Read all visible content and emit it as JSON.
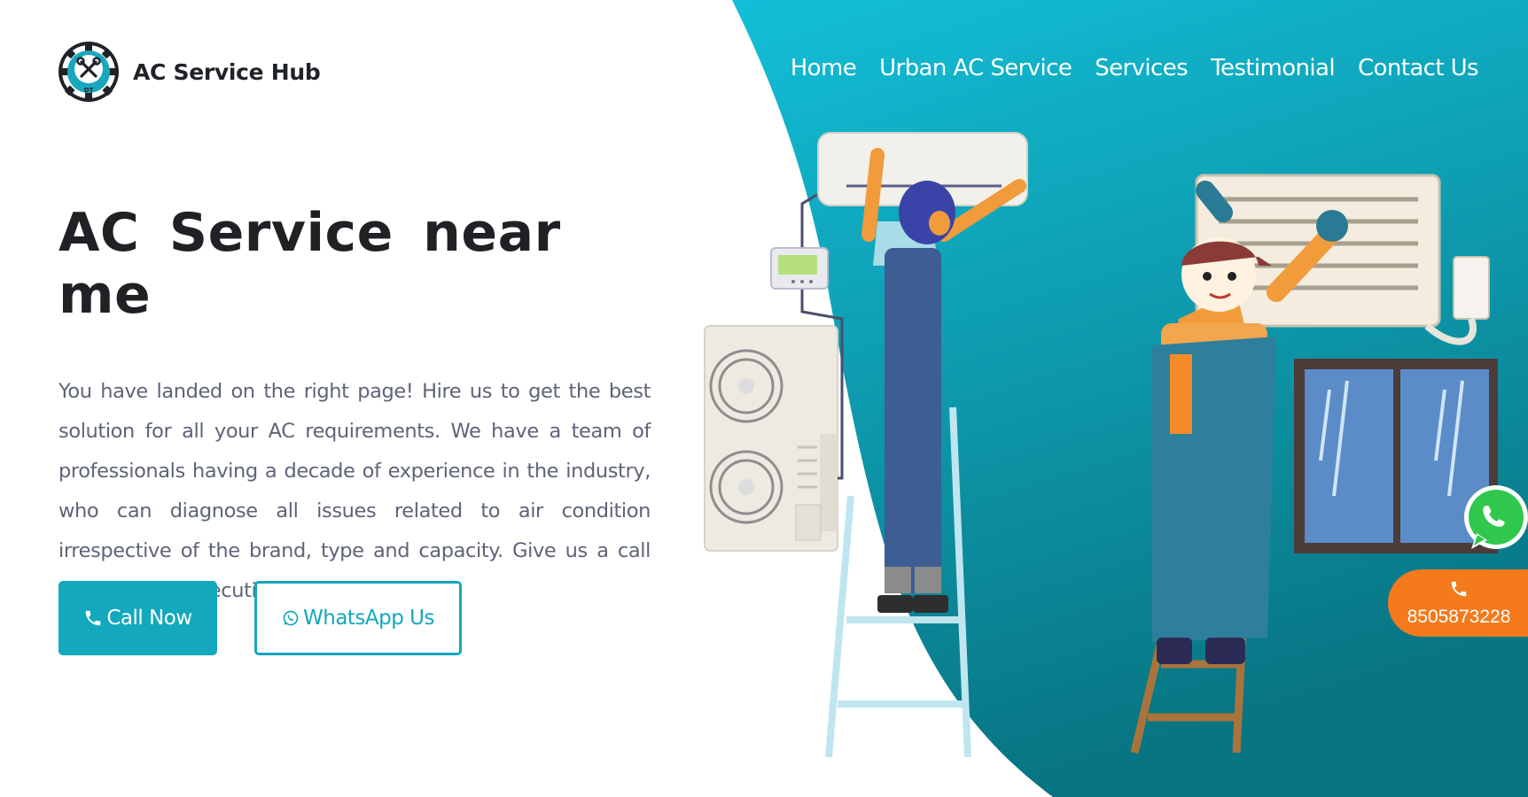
{
  "brand": {
    "name": "AC Service Hub",
    "logo_icon": "gear-tools-logo-icon",
    "logo_initials": "DT"
  },
  "nav": {
    "items": [
      "Home",
      "Urban AC Service",
      "Services",
      "Testimonial",
      "Contact Us"
    ]
  },
  "hero": {
    "title": "AC Service near me",
    "description": "You have landed on the right page! Hire us to get the best solution for all your AC requirements. We have a team of professionals having a decade of experience in the industry, who can diagnose all issues related to air condition irrespective of the brand, type and capacity. Give us a call and our best executive will assist you.",
    "call_button": "Call Now",
    "whatsapp_button": "WhatsApp Us"
  },
  "floating": {
    "phone_number": "8505873228",
    "whatsapp_icon": "whatsapp-icon",
    "phone_icon": "phone-icon"
  },
  "colors": {
    "accent": "#13a8bd",
    "teal_light": "#12bcd6",
    "teal_dark": "#0a7f8f",
    "phone_badge": "#f47a1c",
    "heading": "#1f2125",
    "body_text": "#5e6478"
  }
}
